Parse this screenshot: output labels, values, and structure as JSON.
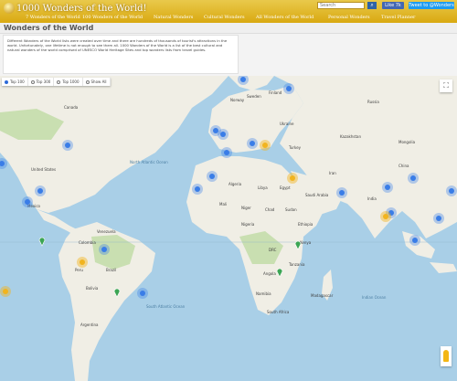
{
  "header": {
    "logo_text": "1000 Wonders of the World!",
    "search_placeholder": "Search",
    "like_label": "Like 7k",
    "tweet_label": "Tweet to @Wonders",
    "nav": [
      "7 Wonders of the World",
      "100 Wonders of the World",
      "Natural Wonders",
      "Cultural Wonders",
      "All Wonders of the World",
      "Personal Wonders",
      "Travel Planner"
    ]
  },
  "page": {
    "title": "Wonders of the World",
    "intro": "Different Wonders of the World lists were created over time and there are hundreds of thousands of tourist's attractions in the world. Unfortunately, one lifetime is not enough to see them all.  1000 Wonders of the World is a list of the best cultural and natural wonders of the world comprised of UNESCO World Heritage Sites and top wonders lists from travel guides."
  },
  "map": {
    "filters": [
      {
        "label": "Top 100",
        "selected": true
      },
      {
        "label": "Top 300",
        "selected": false
      },
      {
        "label": "Top 1000",
        "selected": false
      },
      {
        "label": "Show All",
        "selected": false
      }
    ],
    "fullscreen_icon": "fullscreen-icon",
    "streetview_icon": "pegman-icon",
    "colors": {
      "ocean": "#a9cfe7",
      "land": "#f2efe6",
      "cluster": "#3a7de7",
      "gold": "#f1b41f",
      "green": "#3ca554"
    },
    "labels": {
      "ocean": [
        "North Atlantic Ocean",
        "South Atlantic Ocean",
        "Indian Ocean"
      ],
      "country": [
        "Canada",
        "United States",
        "Mexico",
        "Brazil",
        "Peru",
        "Bolivia",
        "Argentina",
        "Venezuela",
        "Colombia",
        "Russia",
        "Kazakhstan",
        "Mongolia",
        "China",
        "India",
        "Iran",
        "Saudi Arabia",
        "Egypt",
        "Libya",
        "Algeria",
        "Mali",
        "Niger",
        "Chad",
        "Sudan",
        "Ethiopia",
        "Nigeria",
        "DRC",
        "Tanzania",
        "Angola",
        "Namibia",
        "South Africa",
        "Madagascar",
        "Kenya",
        "Turkey",
        "Ukraine",
        "Sweden",
        "Finland",
        "Norway"
      ]
    }
  }
}
